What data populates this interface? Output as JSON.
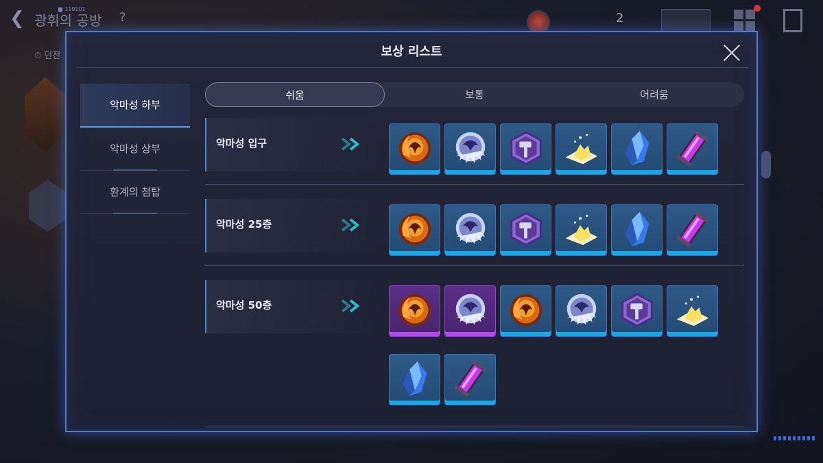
{
  "background": {
    "title": "광휘의 공방",
    "code_label": "■ 110101",
    "help": "?",
    "sub_label": "⏱ 던전",
    "resource_count": "2"
  },
  "modal": {
    "title": "보상 리스트",
    "side_tabs": [
      {
        "label": "악마성 하부",
        "active": true
      },
      {
        "label": "악마성 상부",
        "active": false
      },
      {
        "label": "환계의 첨탑",
        "active": false
      }
    ],
    "difficulty_tabs": [
      {
        "label": "쉬움",
        "active": true
      },
      {
        "label": "보통",
        "active": false
      },
      {
        "label": "어려움",
        "active": false
      }
    ],
    "rows": [
      {
        "label": "악마성 입구",
        "items": [
          {
            "icon": "fire-orb-icon",
            "frame": "blue"
          },
          {
            "icon": "ice-orb-icon",
            "frame": "blue"
          },
          {
            "icon": "hammer-badge-icon",
            "frame": "blue"
          },
          {
            "icon": "gold-dust-icon",
            "frame": "blue"
          },
          {
            "icon": "blue-crystal-icon",
            "frame": "blue"
          },
          {
            "icon": "purple-capsule-icon",
            "frame": "blue"
          }
        ]
      },
      {
        "label": "악마성 25층",
        "items": [
          {
            "icon": "fire-orb-icon",
            "frame": "blue"
          },
          {
            "icon": "ice-orb-icon",
            "frame": "blue"
          },
          {
            "icon": "hammer-badge-icon",
            "frame": "blue"
          },
          {
            "icon": "gold-dust-icon",
            "frame": "blue"
          },
          {
            "icon": "blue-crystal-icon",
            "frame": "blue"
          },
          {
            "icon": "purple-capsule-icon",
            "frame": "blue"
          }
        ]
      },
      {
        "label": "악마성 50층",
        "items": [
          {
            "icon": "fire-orb-icon",
            "frame": "purple"
          },
          {
            "icon": "ice-orb-icon",
            "frame": "purple"
          },
          {
            "icon": "fire-orb-icon",
            "frame": "blue"
          },
          {
            "icon": "ice-orb-icon",
            "frame": "blue"
          },
          {
            "icon": "hammer-badge-icon",
            "frame": "blue"
          },
          {
            "icon": "gold-dust-icon",
            "frame": "blue"
          },
          {
            "icon": "blue-crystal-icon",
            "frame": "blue"
          },
          {
            "icon": "purple-capsule-icon",
            "frame": "blue"
          }
        ]
      }
    ]
  },
  "colors": {
    "modal_border": "#4f7cc8",
    "item_blue": "#2f5a87",
    "item_purple": "#5a2f87",
    "accent_cyan": "#1aa7e8",
    "chevron": "#2fb8c8"
  }
}
